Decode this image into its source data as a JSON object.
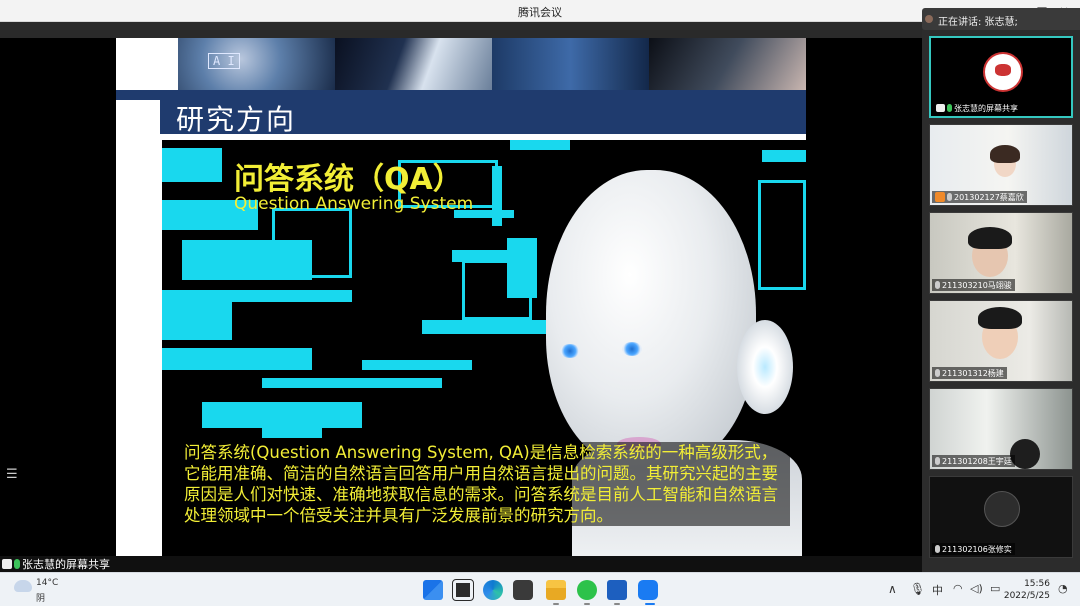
{
  "window": {
    "title": "腾讯会议"
  },
  "slide": {
    "banner_ai_text": "A I",
    "title": "研究方向",
    "qa_title": "问答系统（QA）",
    "qa_subtitle": "Question Answering System",
    "description": "问答系统(Question Answering System, QA)是信息检索系统的一种高级形式，它能用准确、简洁的自然语言回答用户用自然语言提出的问题。其研究兴起的主要原因是人们对快速、准确地获取信息的需求。问答系统是目前人工智能和自然语言处理领域中一个倍受关注并具有广泛发展前景的研究方向。"
  },
  "share": {
    "sharer_label": "张志慧的屏幕共享"
  },
  "speaking": {
    "label": "正在讲话: 张志慧;"
  },
  "participants": [
    {
      "label": "张志慧的屏幕共享",
      "icon": "avatar-cartoon"
    },
    {
      "label": "201302127蔡嘉欣"
    },
    {
      "label": "211303210马翊骏"
    },
    {
      "label": "211301312杨建"
    },
    {
      "label": "211301208王宇廷"
    },
    {
      "label": "211302106张修实"
    }
  ],
  "taskbar": {
    "weather_temp": "14°C",
    "weather_desc": "阴",
    "ime": "中",
    "time": "15:56",
    "date": "2022/5/25"
  },
  "colors": {
    "accent_cyan": "#19d8ee",
    "slide_yellow": "#f2ee36",
    "title_blue": "#1f3b6e"
  }
}
